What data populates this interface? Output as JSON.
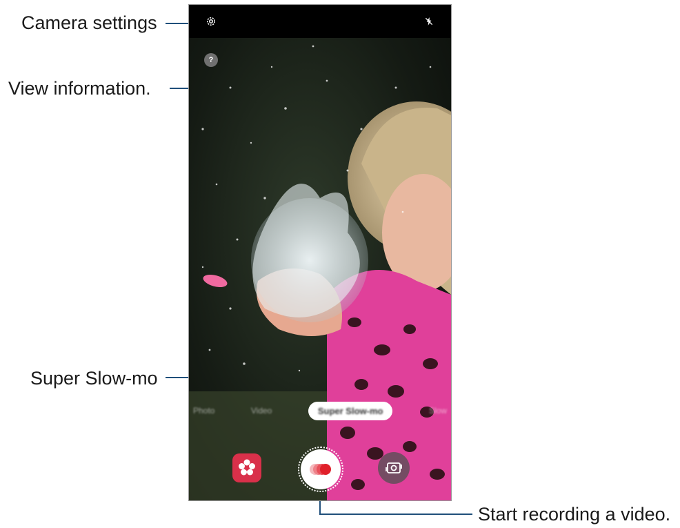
{
  "callouts": {
    "camera_settings": "Camera settings",
    "view_information": "View information.",
    "super_slow_mo": "Super Slow-mo",
    "start_recording": "Start recording a video."
  },
  "camera": {
    "info_label": "?",
    "modes": [
      "Photo",
      "Video",
      "Super Slow-mo",
      "Slow"
    ],
    "active_mode": "Super Slow-mo"
  },
  "icons": {
    "settings": "gear-icon",
    "flash": "flash-off-icon",
    "info": "question-icon",
    "bixby_vision": "flower-icon",
    "record": "super-slow-mo-record-icon",
    "switch_camera": "switch-camera-icon"
  },
  "colors": {
    "callout_line": "#1f4f7a",
    "bixby_button": "#d9304a",
    "record_dot": "#e0202a"
  }
}
